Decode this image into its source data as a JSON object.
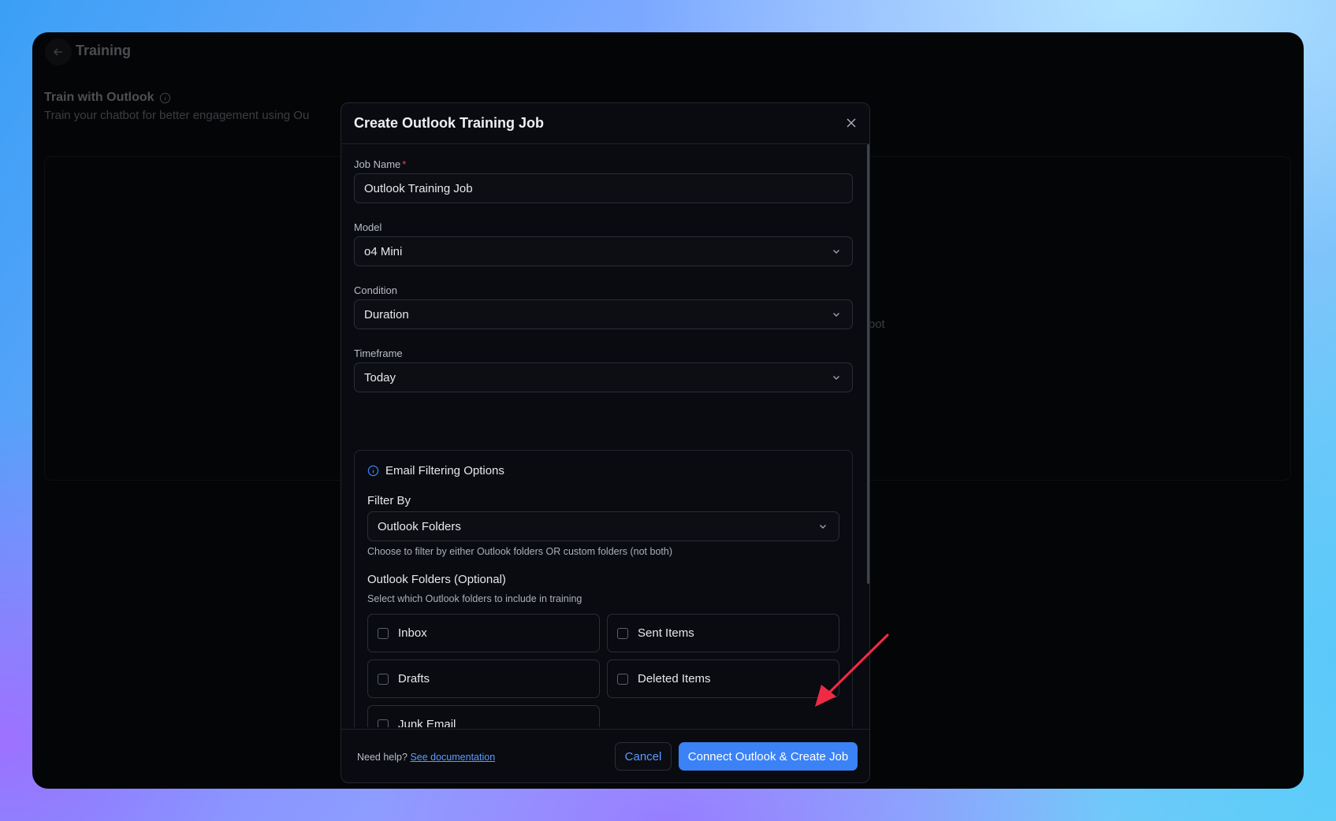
{
  "background_page": {
    "title": "Training",
    "section_title": "Train with Outlook",
    "section_subtitle": "Train your chatbot for better engagement using Ou",
    "card_text_fragment": "ur chatbot"
  },
  "modal": {
    "title": "Create Outlook Training Job",
    "job_name": {
      "label": "Job Name",
      "required_mark": "*",
      "value": "Outlook Training Job"
    },
    "model": {
      "label": "Model",
      "value": "o4 Mini"
    },
    "condition": {
      "label": "Condition",
      "value": "Duration"
    },
    "timeframe": {
      "label": "Timeframe",
      "value": "Today"
    },
    "filtering": {
      "heading": "Email Filtering Options",
      "filter_by_label": "Filter By",
      "filter_by_value": "Outlook Folders",
      "filter_by_hint": "Choose to filter by either Outlook folders OR custom folders (not both)",
      "folders_label": "Outlook Folders (Optional)",
      "folders_hint": "Select which Outlook folders to include in training",
      "folders": [
        {
          "label": "Inbox",
          "checked": false
        },
        {
          "label": "Sent Items",
          "checked": false
        },
        {
          "label": "Drafts",
          "checked": false
        },
        {
          "label": "Deleted Items",
          "checked": false
        },
        {
          "label": "Junk Email",
          "checked": false
        }
      ]
    },
    "footer": {
      "help_text": "Need help?",
      "help_link": "See documentation",
      "cancel": "Cancel",
      "submit": "Connect Outlook & Create Job"
    }
  },
  "colors": {
    "accent": "#3b82f6",
    "link": "#5b9cff",
    "required": "#ef4444",
    "annotation_arrow": "#ef2b44"
  }
}
